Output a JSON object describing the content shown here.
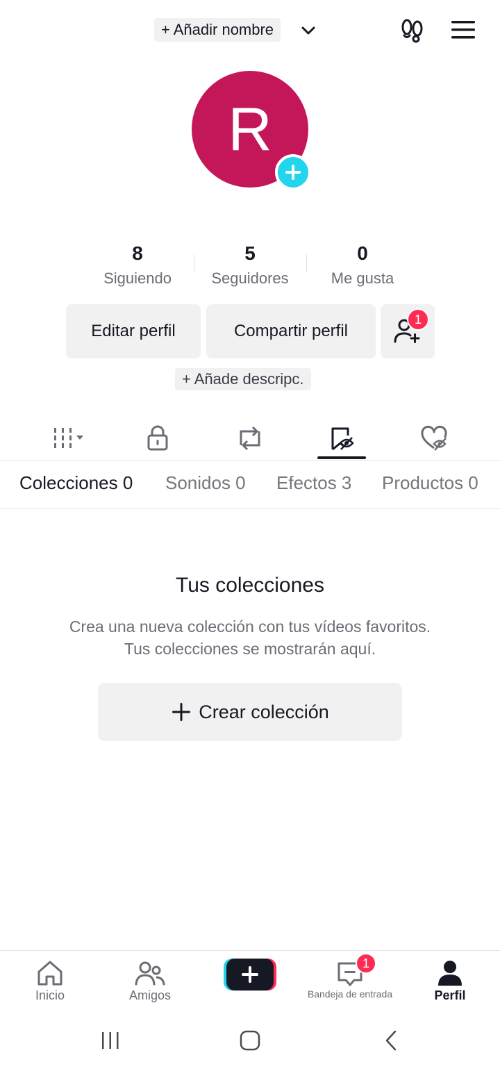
{
  "header": {
    "add_name": "+ Añadir nombre"
  },
  "avatar": {
    "initial": "R",
    "color": "#c4175a"
  },
  "stats": [
    {
      "value": "8",
      "label": "Siguiendo"
    },
    {
      "value": "5",
      "label": "Seguidores"
    },
    {
      "value": "0",
      "label": "Me gusta"
    }
  ],
  "actions": {
    "edit_profile": "Editar perfil",
    "share_profile": "Compartir perfil",
    "friend_badge": "1"
  },
  "add_description": "+ Añade descripc.",
  "content_tabs": [
    {
      "icon": "grid-icon",
      "active": false
    },
    {
      "icon": "lock-icon",
      "active": false
    },
    {
      "icon": "repost-icon",
      "active": false
    },
    {
      "icon": "bookmark-icon",
      "active": true
    },
    {
      "icon": "heart-hidden-icon",
      "active": false
    }
  ],
  "sub_tabs": [
    {
      "label": "Colecciones 0",
      "active": true
    },
    {
      "label": "Sonidos 0",
      "active": false
    },
    {
      "label": "Efectos 3",
      "active": false
    },
    {
      "label": "Productos 0",
      "active": false
    }
  ],
  "empty_state": {
    "title": "Tus colecciones",
    "line1": "Crea una nueva colección con tus vídeos favoritos.",
    "line2": "Tus colecciones se mostrarán aquí.",
    "button": "Crear colección"
  },
  "bottom_nav": {
    "home": "Inicio",
    "friends": "Amigos",
    "inbox": "Bandeja de entrada",
    "inbox_badge": "1",
    "profile": "Perfil"
  },
  "colors": {
    "accent_red": "#fe2c55",
    "accent_cyan": "#20d5ec",
    "text": "#161823",
    "muted": "#6b6d75"
  }
}
